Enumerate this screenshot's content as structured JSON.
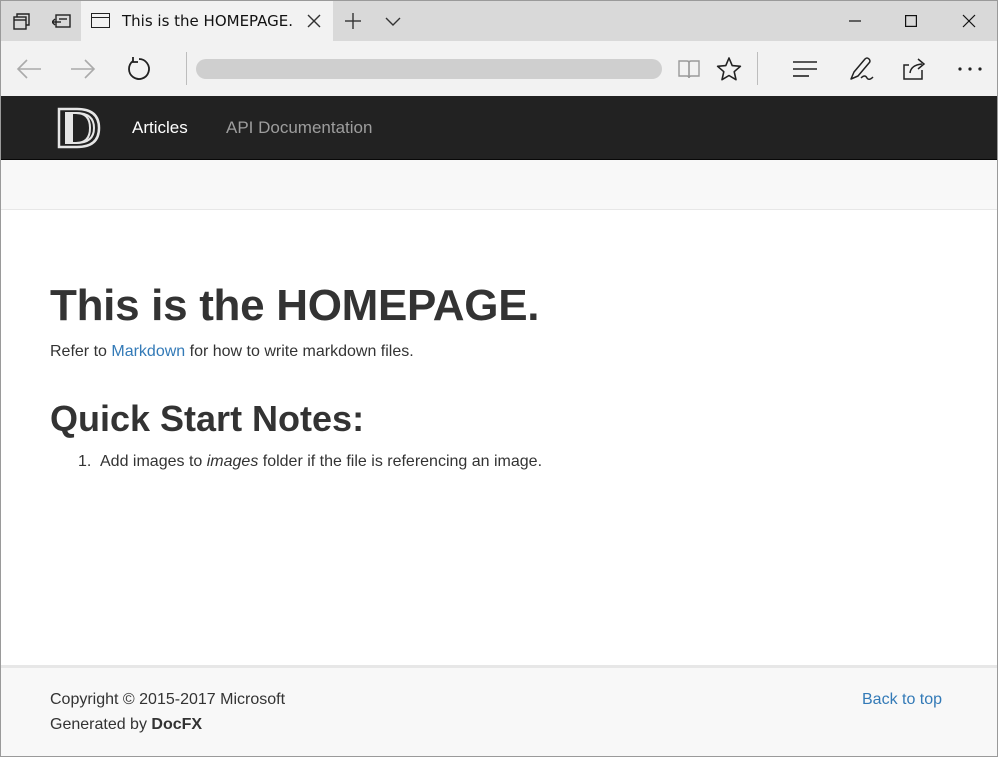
{
  "browser": {
    "tab_title": "This is the HOMEPAGE.",
    "icons": {
      "tab_preview": "tab-preview-icon",
      "set_aside": "set-aside-tabs-icon",
      "page": "page-icon",
      "close_tab": "close-icon",
      "new_tab": "plus-icon",
      "tab_list": "chevron-down-icon",
      "minimize": "minimize-icon",
      "maximize": "maximize-icon",
      "close_window": "close-icon",
      "back": "back-arrow-icon",
      "forward": "forward-arrow-icon",
      "refresh": "refresh-icon",
      "reading_view": "book-icon",
      "favorite": "star-icon",
      "hub": "hub-icon",
      "web_note": "pen-icon",
      "share": "share-icon",
      "more": "more-icon"
    }
  },
  "site": {
    "nav": {
      "articles": "Articles",
      "api": "API Documentation"
    },
    "accent_color": "#337ab7",
    "navbar_color": "#222222"
  },
  "content": {
    "title_prefix": "This is the ",
    "title_bold": "HOMEPAGE",
    "title_suffix": ".",
    "refer_prefix": "Refer to ",
    "refer_link": "Markdown",
    "refer_suffix": " for how to write markdown files.",
    "quick_start_heading": "Quick Start Notes:",
    "notes": [
      {
        "number": "1.",
        "prefix": "Add images to ",
        "emphasis": "images",
        "suffix": " folder if the file is referencing an image."
      }
    ]
  },
  "footer": {
    "copyright": "Copyright © 2015-2017 Microsoft",
    "generated_prefix": "Generated by ",
    "generated_bold": "DocFX",
    "back_to_top": "Back to top"
  }
}
